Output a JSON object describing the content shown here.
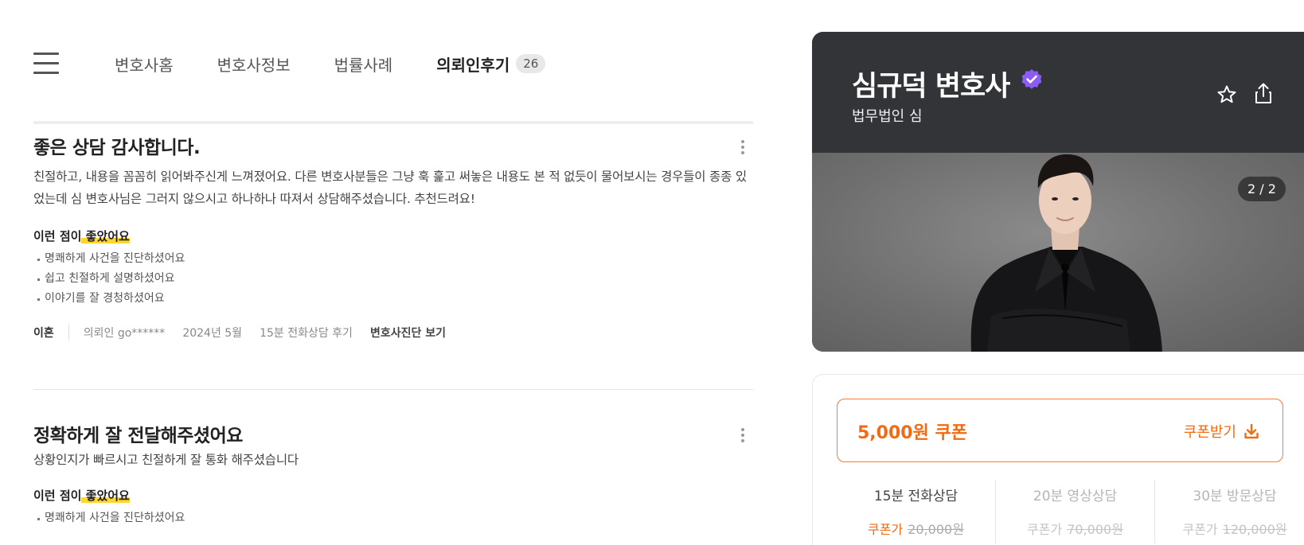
{
  "nav": {
    "tabs": [
      {
        "label": "변호사홈"
      },
      {
        "label": "변호사정보"
      },
      {
        "label": "법률사례"
      },
      {
        "label": "의뢰인후기",
        "count": "26",
        "active": true
      }
    ]
  },
  "reviews": [
    {
      "title": "좋은 상담 감사합니다.",
      "body": "친절하고, 내용을 꼼꼼히 읽어봐주신게 느껴졌어요. 다른 변호사분들은 그냥 훅 훑고 써놓은 내용도 본 적 없듯이 물어보시는 경우들이 종종 있었는데 심 변호사님은 그러지 않으시고 하나하나 따져서 상담해주셨습니다. 추천드려요!",
      "good_label_prefix": "이런 점이",
      "good_label_highlight": " 좋았어요",
      "good_points": [
        "명쾌하게 사건을 진단하셨어요",
        "쉽고 친절하게 설명하셨어요",
        "이야기를 잘 경청하셨어요"
      ],
      "category": "이혼",
      "client": "의뢰인 go******",
      "date": "2024년 5월",
      "type": "15분 전화상담 후기",
      "diag_link": "변호사진단 보기"
    },
    {
      "title": "정확하게 잘 전달해주셨어요",
      "body": "상황인지가 빠르시고 친절하게 잘 통화 해주셨습니다",
      "good_label_prefix": "이런 점이",
      "good_label_highlight": " 좋았어요",
      "good_points": [
        "명쾌하게 사건을 진단하셨어요"
      ]
    }
  ],
  "profile": {
    "name": "심규덕 변호사",
    "firm": "법무법인 심",
    "photo_counter": "2 / 2",
    "icons": [
      "verified-badge-icon",
      "star-icon",
      "share-icon",
      "hamburger-menu-icon",
      "kebab-menu-icon",
      "download-icon"
    ],
    "colors": {
      "header_bg": "#333437",
      "verified": "#8b5cf6",
      "accent": "#f26a12",
      "highlight": "#ffd52e"
    }
  },
  "booking": {
    "coupon_amount": "5,000원 쿠폰",
    "coupon_get": "쿠폰받기",
    "consults": [
      {
        "label": "15분 전화상담",
        "coupon_prefix": "쿠폰가",
        "original_price": "20,000원"
      },
      {
        "label": "20분 영상상담",
        "coupon_prefix": "쿠폰가",
        "original_price": "70,000원"
      },
      {
        "label": "30분 방문상담",
        "coupon_prefix": "쿠폰가",
        "original_price": "120,000원"
      }
    ]
  }
}
